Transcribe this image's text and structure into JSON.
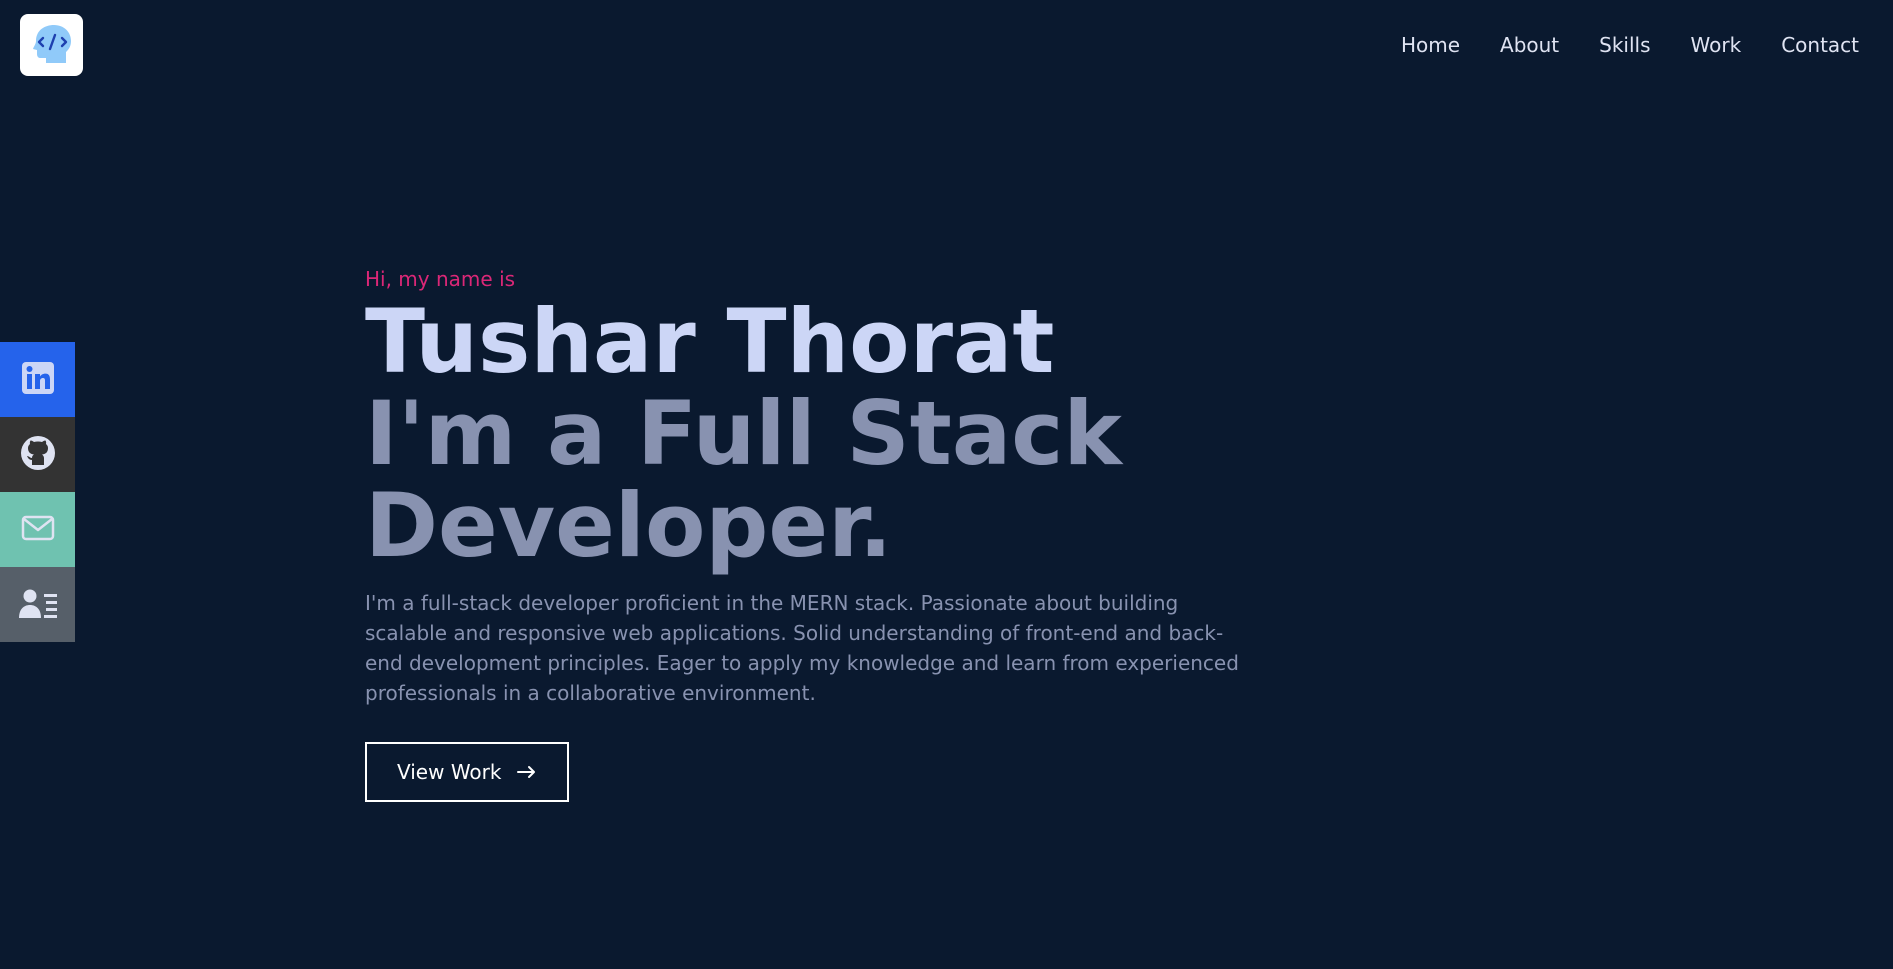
{
  "logo": {
    "icon": "code-head-icon"
  },
  "nav": {
    "items": [
      {
        "label": "Home"
      },
      {
        "label": "About"
      },
      {
        "label": "Skills"
      },
      {
        "label": "Work"
      },
      {
        "label": "Contact"
      }
    ]
  },
  "social": {
    "items": [
      {
        "icon": "linkedin-icon",
        "color": "#2563eb"
      },
      {
        "icon": "github-icon",
        "color": "#333333"
      },
      {
        "icon": "mail-icon",
        "color": "#6fc2b0"
      },
      {
        "icon": "resume-icon",
        "color": "#565f69"
      }
    ]
  },
  "hero": {
    "greeting": "Hi, my name is",
    "name": "Tushar Thorat",
    "title": "I'm a Full Stack Developer.",
    "description": "I'm a full-stack developer proficient in the MERN stack. Passionate about building scalable and responsive web applications. Solid understanding of front-end and back-end development principles. Eager to apply my knowledge and learn from experienced professionals in a collaborative environment.",
    "cta_label": "View Work",
    "cta_icon": "arrow-right-icon"
  },
  "colors": {
    "background": "#0a192f",
    "accent": "#db2777",
    "name": "#ccd6f6",
    "muted": "#8892b0"
  }
}
